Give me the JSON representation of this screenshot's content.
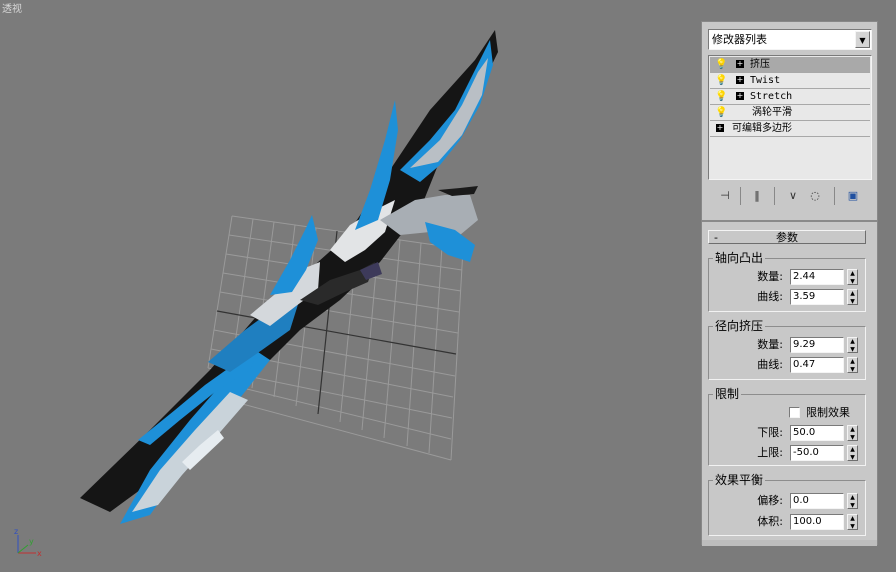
{
  "viewport": {
    "label": "透视",
    "axis_labels": {
      "x": "x",
      "y": "y",
      "z": "z"
    }
  },
  "panel": {
    "modifier_list": {
      "value": "修改器列表",
      "arrow": "▼"
    },
    "stack": [
      {
        "label": "挤压",
        "selected": true,
        "has_bulb": true,
        "has_plus": true
      },
      {
        "label": "Twist",
        "selected": false,
        "has_bulb": true,
        "has_plus": true
      },
      {
        "label": "Stretch",
        "selected": false,
        "has_bulb": true,
        "has_plus": true
      },
      {
        "label": "涡轮平滑",
        "selected": false,
        "has_bulb": true,
        "has_plus": false
      },
      {
        "label": "可编辑多边形",
        "selected": false,
        "has_bulb": false,
        "has_plus": true
      }
    ],
    "toolbar": {
      "pin_icon": "pin-stack-icon",
      "show_end_icon": "show-end-result-icon",
      "make_unique_icon": "make-unique-icon",
      "remove_icon": "remove-modifier-icon",
      "configure_icon": "configure-modifier-sets-icon"
    },
    "rollout": {
      "collapse": "-",
      "title": "参数",
      "axial_bulge": {
        "title": "轴向凸出",
        "amount_label": "数量:",
        "amount": "2.44",
        "curve_label": "曲线:",
        "curve": "3.59"
      },
      "radial_squeeze": {
        "title": "径向挤压",
        "amount_label": "数量:",
        "amount": "9.29",
        "curve_label": "曲线:",
        "curve": "0.47"
      },
      "limits": {
        "title": "限制",
        "limit_effect_label": "限制效果",
        "limit_effect_checked": false,
        "lower_label": "下限:",
        "lower": "50.0",
        "upper_label": "上限:",
        "upper": "-50.0"
      },
      "effect_balance": {
        "title": "效果平衡",
        "bias_label": "偏移:",
        "bias": "0.0",
        "volume_label": "体积:",
        "volume": "100.0"
      }
    }
  },
  "colors": {
    "viewport_bg": "#7b7b7b",
    "panel_bg": "#c8c8c8",
    "accent_blue": "#1e90d8"
  }
}
